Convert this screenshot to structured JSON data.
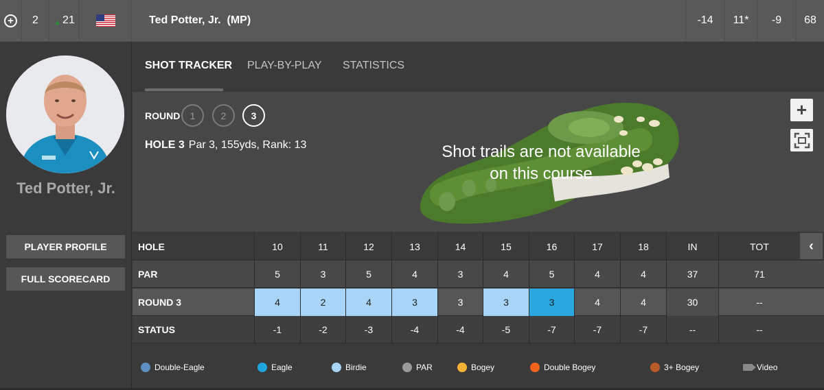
{
  "topbar": {
    "position": "2",
    "movement": "21",
    "player_name": "Ted Potter, Jr.  (MP)",
    "to_par": "-14",
    "thru": "11*",
    "today": "-9",
    "round_score": "68"
  },
  "sidebar": {
    "player_name": "Ted Potter, Jr.",
    "profile_button": "PLAYER PROFILE",
    "scorecard_button": "FULL SCORECARD"
  },
  "tabs": [
    "SHOT TRACKER",
    "PLAY-BY-PLAY",
    "STATISTICS"
  ],
  "course": {
    "round_label": "ROUND",
    "rounds": [
      "1",
      "2",
      "3"
    ],
    "active_round": "3",
    "hole_label": "HOLE 3",
    "hole_details": "Par 3, 155yds, Rank: 13",
    "message_line1": "Shot trails are not available",
    "message_line2": "on this course",
    "zoom_label": "+"
  },
  "scorecard": {
    "row_labels": [
      "HOLE",
      "PAR",
      "ROUND 3",
      "STATUS"
    ],
    "holes": [
      "10",
      "11",
      "12",
      "13",
      "14",
      "15",
      "16",
      "17",
      "18",
      "IN",
      "TOT"
    ],
    "par": [
      "5",
      "3",
      "5",
      "4",
      "3",
      "4",
      "5",
      "4",
      "4",
      "37",
      "71"
    ],
    "round": [
      "4",
      "2",
      "4",
      "3",
      "3",
      "3",
      "3",
      "4",
      "4",
      "30",
      "--"
    ],
    "round_result": [
      "birdie",
      "birdie",
      "birdie",
      "birdie",
      "par",
      "birdie",
      "eagle",
      "par",
      "par",
      "",
      ""
    ],
    "status": [
      "-1",
      "-2",
      "-3",
      "-4",
      "-4",
      "-5",
      "-7",
      "-7",
      "-7",
      "--",
      "--"
    ]
  },
  "legend": [
    {
      "label": "Double-Eagle",
      "color": "#5b8fbf"
    },
    {
      "label": "Eagle",
      "color": "#1fa6e0"
    },
    {
      "label": "Birdie",
      "color": "#a8d5f7"
    },
    {
      "label": "PAR",
      "color": "#9a9a9a"
    },
    {
      "label": "Bogey",
      "color": "#f5b335"
    },
    {
      "label": "Double Bogey",
      "color": "#f0641e"
    },
    {
      "label": "3+ Bogey",
      "color": "#b85a2a"
    },
    {
      "label": "Video",
      "icon": "video-camera-icon"
    }
  ],
  "colors": {
    "birdie": "#a8d5f7",
    "eagle": "#2aa7df",
    "topbar_bg": "#595959",
    "panel_bg": "#3a3a3a"
  }
}
